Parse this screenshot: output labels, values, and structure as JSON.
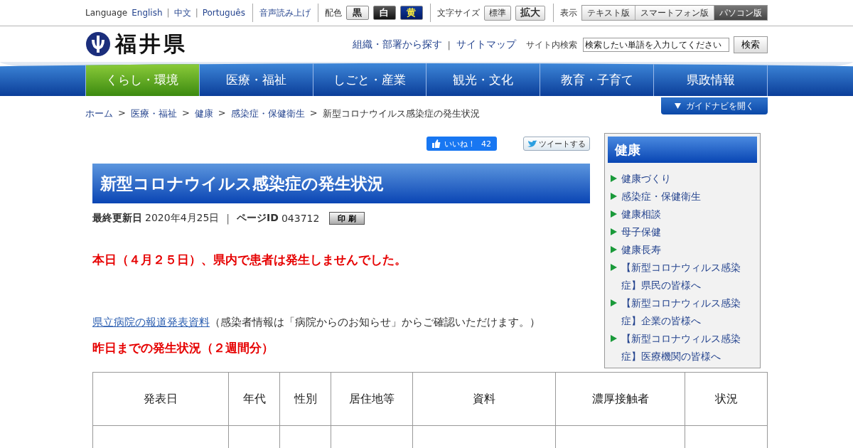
{
  "top_bar": {
    "language": {
      "label": "Language",
      "links": [
        {
          "label": "English",
          "separator": "|"
        },
        {
          "label": "中文",
          "separator": "|"
        },
        {
          "label": "Português"
        }
      ]
    },
    "read_aloud": "音声読み上げ",
    "color_scheme": {
      "label": "配色",
      "options": [
        {
          "label": "黒",
          "kind": "light"
        },
        {
          "label": "白",
          "kind": "dark"
        },
        {
          "label": "黄",
          "kind": "navy"
        }
      ]
    },
    "font_size": {
      "label": "文字サイズ",
      "options": [
        {
          "label": "標準",
          "kind": "normal"
        },
        {
          "label": "拡大",
          "kind": "large"
        }
      ]
    },
    "display": {
      "label": "表示",
      "options": [
        {
          "label": "テキスト版",
          "selected": false
        },
        {
          "label": "スマートフォン版",
          "selected": false
        },
        {
          "label": "パソコン版",
          "selected": true
        }
      ]
    }
  },
  "header": {
    "logo_text": "福井県",
    "links": [
      {
        "label": "組織・部署から探す",
        "separator": "|"
      },
      {
        "label": "サイトマップ"
      }
    ],
    "search": {
      "label": "サイト内検索",
      "value": "検索したい単語を入力してください",
      "button": "検索"
    }
  },
  "nav": [
    {
      "label": "くらし・環境",
      "selected": true
    },
    {
      "label": "医療・福祉",
      "selected": false
    },
    {
      "label": "しごと・産業",
      "selected": false
    },
    {
      "label": "観光・文化",
      "selected": false
    },
    {
      "label": "教育・子育て",
      "selected": false
    },
    {
      "label": "県政情報",
      "selected": false
    }
  ],
  "guide_button": "ガイドナビを開く",
  "breadcrumb": [
    {
      "label": "ホーム",
      "separator": ">"
    },
    {
      "label": "医療・福祉",
      "separator": ">"
    },
    {
      "label": "健康",
      "separator": ">"
    },
    {
      "label": "感染症・保健衛生",
      "separator": ">"
    },
    {
      "label": "新型コロナウイルス感染症の発生状況"
    }
  ],
  "social": {
    "like": {
      "label": "いいね！",
      "count": "42"
    },
    "tweet": "ツイートする"
  },
  "page": {
    "title": "新型コロナウイルス感染症の発生状況",
    "meta": {
      "updated_label": "最終更新日",
      "updated": "2020年4月25日",
      "separator": "|",
      "id_label": "ページID",
      "id": "043712"
    },
    "print_button": "印 刷",
    "notice": "本日（４月２５日）、県内で患者は発生しませんでした。",
    "report": {
      "link": "県立病院の報道発表資料",
      "text": "（感染者情報は「病院からのお知らせ」からご確認いただけます。）"
    },
    "section_heading": "昨日までの発生状況（２週間分）"
  },
  "sidebar": {
    "title": "健康",
    "items": [
      "健康づくり",
      "感染症・保健衛生",
      "健康相談",
      "母子保健",
      "健康長寿",
      "【新型コロナウィルス感染症】県民の皆様へ",
      "【新型コロナウィルス感染症】企業の皆様へ",
      "【新型コロナウィルス感染症】医療機関の皆様へ"
    ]
  },
  "table": {
    "columns": [
      "発表日",
      "年代",
      "性別",
      "居住地等",
      "資料",
      "濃厚接触者",
      "状況"
    ]
  }
}
